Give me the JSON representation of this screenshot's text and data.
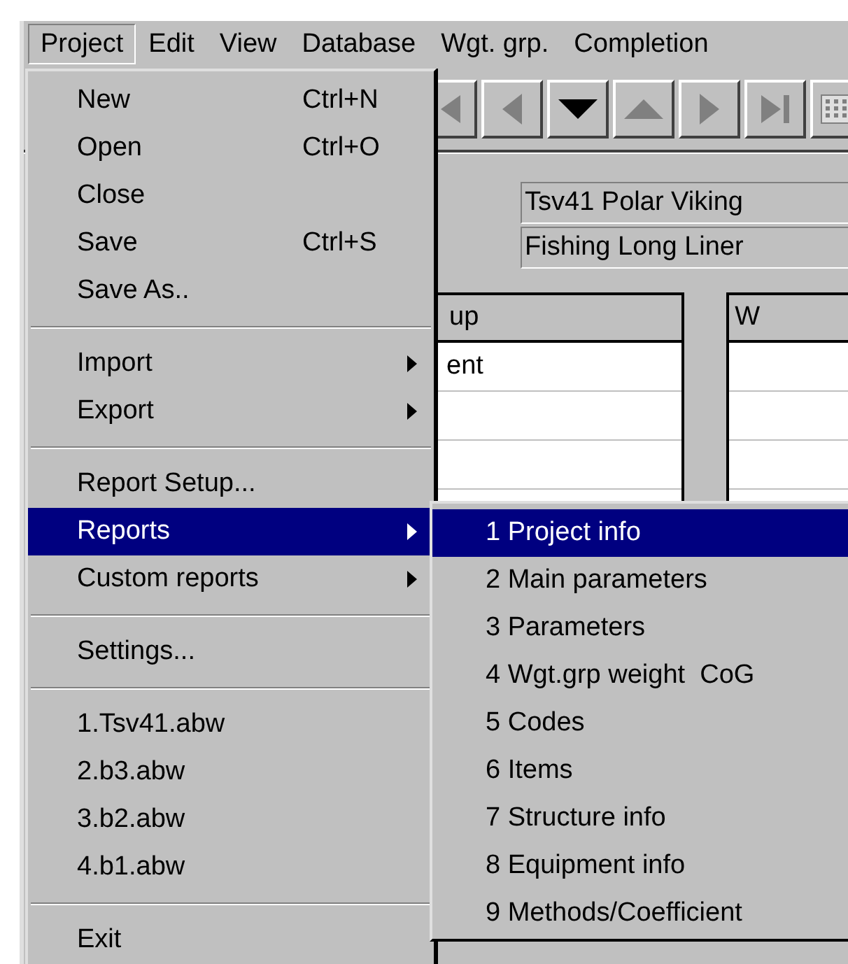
{
  "menubar": [
    {
      "label": "Project",
      "selected": true
    },
    {
      "label": "Edit",
      "selected": false
    },
    {
      "label": "View",
      "selected": false
    },
    {
      "label": "Database",
      "selected": false
    },
    {
      "label": "Wgt. grp.",
      "selected": false
    },
    {
      "label": "Completion",
      "selected": false
    }
  ],
  "toolbar": [
    {
      "kind": "first",
      "disabled": true
    },
    {
      "kind": "prev",
      "disabled": true
    },
    {
      "kind": "down",
      "disabled": false
    },
    {
      "kind": "up",
      "disabled": true
    },
    {
      "kind": "next",
      "disabled": true
    },
    {
      "kind": "last",
      "disabled": true
    },
    {
      "kind": "grid",
      "disabled": true
    }
  ],
  "fields": [
    {
      "value": "Tsv41 Polar Viking"
    },
    {
      "value": "Fishing Long Liner"
    }
  ],
  "tables": [
    {
      "header": "up",
      "rows": [
        "ent",
        "",
        "",
        ""
      ]
    },
    {
      "header": "W",
      "rows": [
        "",
        "",
        "",
        ""
      ]
    }
  ],
  "project_menu": [
    {
      "kind": "item",
      "label": "New",
      "shortcut": "Ctrl+N",
      "submenu": false,
      "selected": false
    },
    {
      "kind": "item",
      "label": "Open",
      "shortcut": "Ctrl+O",
      "submenu": false,
      "selected": false
    },
    {
      "kind": "item",
      "label": "Close",
      "submenu": false,
      "selected": false
    },
    {
      "kind": "item",
      "label": "Save",
      "shortcut": "Ctrl+S",
      "submenu": false,
      "selected": false
    },
    {
      "kind": "item",
      "label": "Save As..",
      "submenu": false,
      "selected": false
    },
    {
      "kind": "separator"
    },
    {
      "kind": "item",
      "label": "Import",
      "submenu": true,
      "selected": false
    },
    {
      "kind": "item",
      "label": "Export",
      "submenu": true,
      "selected": false
    },
    {
      "kind": "separator"
    },
    {
      "kind": "item",
      "label": "Report Setup...",
      "submenu": false,
      "selected": false
    },
    {
      "kind": "item",
      "label": "Reports",
      "submenu": true,
      "selected": true
    },
    {
      "kind": "item",
      "label": "Custom reports",
      "submenu": true,
      "selected": false
    },
    {
      "kind": "separator"
    },
    {
      "kind": "item",
      "label": "Settings...",
      "submenu": false,
      "selected": false
    },
    {
      "kind": "separator"
    },
    {
      "kind": "item",
      "label": "1.Tsv41.abw",
      "submenu": false,
      "selected": false
    },
    {
      "kind": "item",
      "label": "2.b3.abw",
      "submenu": false,
      "selected": false
    },
    {
      "kind": "item",
      "label": "3.b2.abw",
      "submenu": false,
      "selected": false
    },
    {
      "kind": "item",
      "label": "4.b1.abw",
      "submenu": false,
      "selected": false
    },
    {
      "kind": "separator"
    },
    {
      "kind": "item",
      "label": "Exit",
      "submenu": false,
      "selected": false
    }
  ],
  "reports_menu": [
    {
      "label": "1 Project info",
      "selected": true
    },
    {
      "label": "2 Main parameters",
      "selected": false
    },
    {
      "label": "3 Parameters",
      "selected": false
    },
    {
      "label": "4 Wgt.grp weight  CoG",
      "selected": false
    },
    {
      "label": "5 Codes",
      "selected": false
    },
    {
      "label": "6 Items",
      "selected": false
    },
    {
      "label": "7 Structure info",
      "selected": false
    },
    {
      "label": "8 Equipment info",
      "selected": false
    },
    {
      "label": "9 Methods/Coefficient",
      "selected": false
    }
  ]
}
